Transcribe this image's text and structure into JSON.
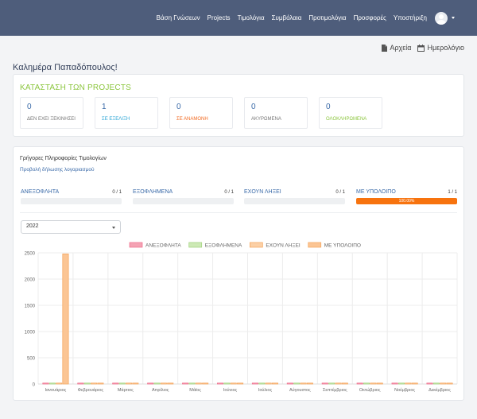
{
  "nav": {
    "items": [
      "Βάση Γνώσεων",
      "Projects",
      "Τιμολόγια",
      "Συμβόλαια",
      "Προτιμολόγια",
      "Προσφορές",
      "Υποστήριξη"
    ]
  },
  "toplinks": {
    "files": "Αρχεία",
    "calendar": "Ημερολόγιο"
  },
  "greeting": "Καλημέρα Παπαδόπουλος!",
  "projects": {
    "title": "ΚΑΤΑΣΤΑΣΗ ΤΩΝ PROJECTS",
    "stats": [
      {
        "value": "0",
        "label": "ΔΕΝ ΕΧΕΙ ΞΕΚΙΝΗΣΕΙ",
        "color": "#777777"
      },
      {
        "value": "1",
        "label": "ΣΕ ΕΞΕΛΙΞΗ",
        "color": "#2aa4d5"
      },
      {
        "value": "0",
        "label": "ΣΕ ΑΝΑΜΟΝΗ",
        "color": "#f26a21"
      },
      {
        "value": "0",
        "label": "ΑΚΥΡΩΜΕΝΑ",
        "color": "#777777"
      },
      {
        "value": "0",
        "label": "ΟΛΟΚΛΗΡΩΜΕΝΑ",
        "color": "#8cc63f"
      }
    ]
  },
  "invoices": {
    "title": "Γρήγορες Πληροφορίες Τιμολογίων",
    "link": "Προβολή δήλωσης λογαριασμού",
    "progress": [
      {
        "label": "ΑΝΕΞΟΦΛΗΤΑ",
        "value": "0 / 1",
        "percent": 0,
        "percent_text": ""
      },
      {
        "label": "ΕΞΟΦΛΗΜΕΝΑ",
        "value": "0 / 1",
        "percent": 0,
        "percent_text": ""
      },
      {
        "label": "ΕΧΟΥΝ ΛΗΞΕΙ",
        "value": "0 / 1",
        "percent": 0,
        "percent_text": ""
      },
      {
        "label": "ΜΕ ΥΠΟΛΟΙΠΟ",
        "value": "1 / 1",
        "percent": 100,
        "percent_text": "100.00%"
      }
    ],
    "year": "2022"
  },
  "chart_data": {
    "type": "bar",
    "categories": [
      "Ιανουάριος",
      "Φεβρουάριος",
      "Μάρτιος",
      "Απρίλιος",
      "Μάϊος",
      "Ιούνιος",
      "Ιούλιος",
      "Αύγουστος",
      "Σεπτέμβριος",
      "Οκτώβριος",
      "Νοέμβριος",
      "Δεκέμβριος"
    ],
    "series": [
      {
        "name": "ΑΝΕΞΟΦΛΗΤΑ",
        "color": "#f4a3b4",
        "border": "#f06b8a",
        "values": [
          0,
          0,
          0,
          0,
          0,
          0,
          0,
          0,
          0,
          0,
          0,
          0
        ]
      },
      {
        "name": "ΕΞΟΦΛΗΜΕΝΑ",
        "color": "#cde9b5",
        "border": "#9fd17a",
        "values": [
          0,
          0,
          0,
          0,
          0,
          0,
          0,
          0,
          0,
          0,
          0,
          0
        ]
      },
      {
        "name": "ΕΧΟΥΝ ΛΗΞΕΙ",
        "color": "#fbd0a6",
        "border": "#f5a45a",
        "values": [
          0,
          0,
          0,
          0,
          0,
          0,
          0,
          0,
          0,
          0,
          0,
          0
        ]
      },
      {
        "name": "ΜΕ ΥΠΟΛΟΙΠΟ",
        "color": "#fbc594",
        "border": "#f5a45a",
        "values": [
          2480,
          0,
          0,
          0,
          0,
          0,
          0,
          0,
          0,
          0,
          0,
          0
        ]
      }
    ],
    "yticks": [
      0,
      500,
      1000,
      1500,
      2000,
      2500
    ],
    "ylim": [
      0,
      2500
    ],
    "grid": true,
    "legend": "top"
  }
}
